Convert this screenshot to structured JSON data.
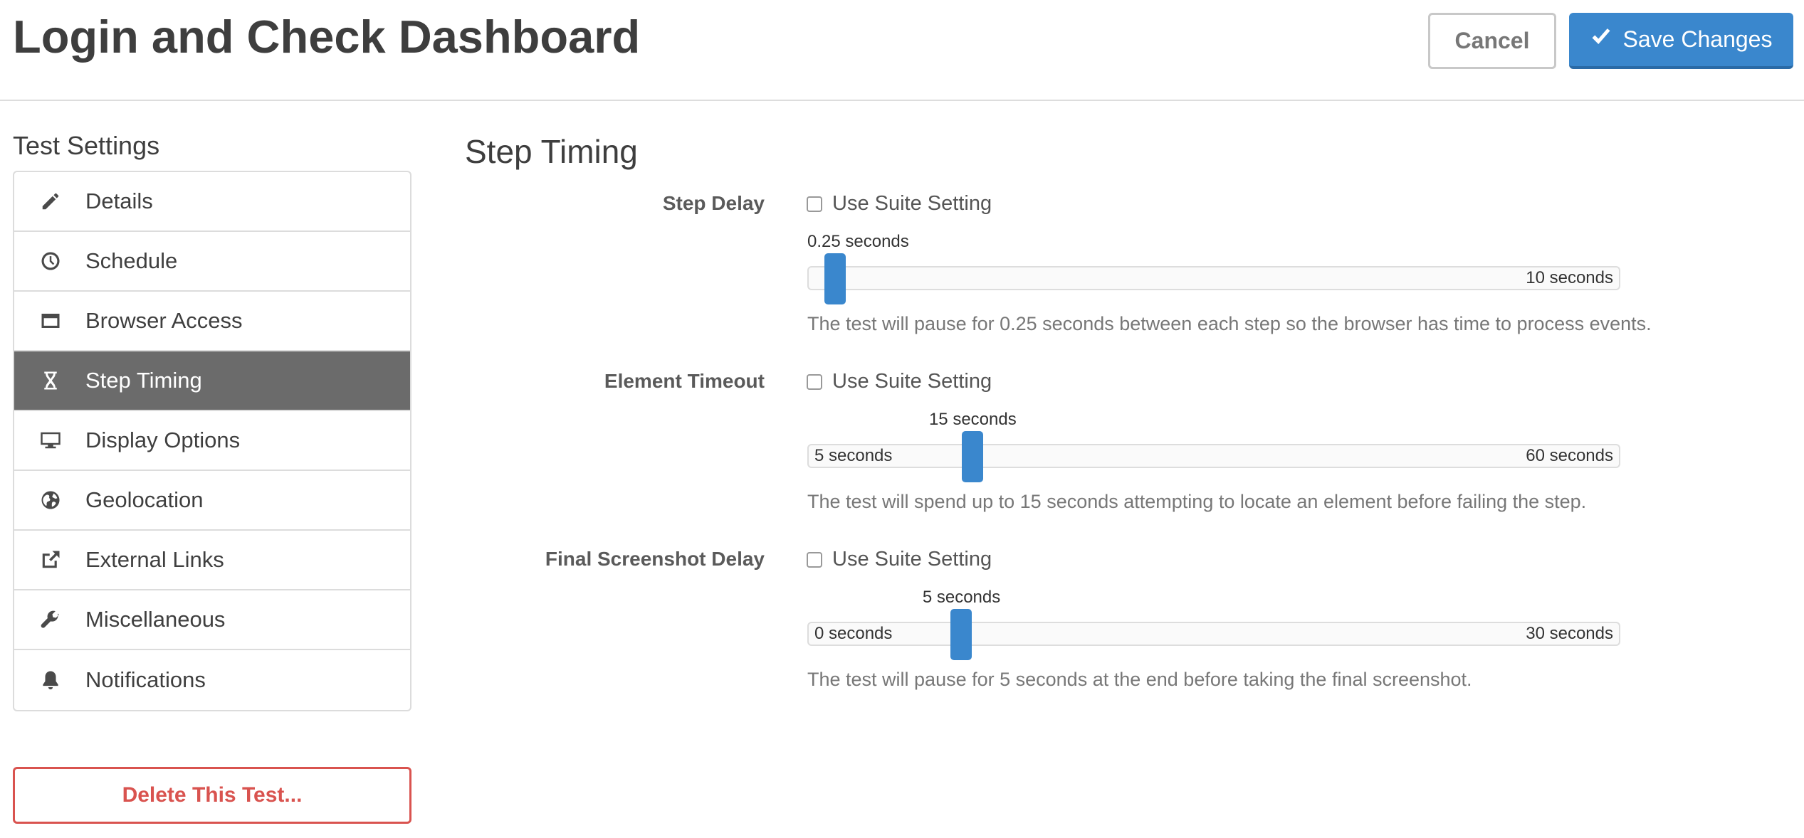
{
  "header": {
    "title": "Login and Check Dashboard",
    "cancel_label": "Cancel",
    "save_label": "Save Changes"
  },
  "sidebar": {
    "title": "Test Settings",
    "items": [
      {
        "label": "Details",
        "icon": "pencil-icon"
      },
      {
        "label": "Schedule",
        "icon": "clock-icon"
      },
      {
        "label": "Browser Access",
        "icon": "browser-window-icon"
      },
      {
        "label": "Step Timing",
        "icon": "hourglass-icon",
        "active": true
      },
      {
        "label": "Display Options",
        "icon": "monitor-icon"
      },
      {
        "label": "Geolocation",
        "icon": "globe-icon"
      },
      {
        "label": "External Links",
        "icon": "external-link-icon"
      },
      {
        "label": "Miscellaneous",
        "icon": "wrench-icon"
      },
      {
        "label": "Notifications",
        "icon": "bell-icon"
      }
    ],
    "delete_label": "Delete This Test..."
  },
  "main": {
    "title": "Step Timing",
    "fields": [
      {
        "label": "Step Delay",
        "suite_label": "Use Suite Setting",
        "suite_checked": false,
        "value_label": "0.25 seconds",
        "min_label": "",
        "max_label": "10 seconds",
        "value": 0.25,
        "min": 0.25,
        "max": 10,
        "description": "The test will pause for 0.25 seconds between each step so the browser has time to process events."
      },
      {
        "label": "Element Timeout",
        "suite_label": "Use Suite Setting",
        "suite_checked": false,
        "value_label": "15 seconds",
        "min_label": "5 seconds",
        "max_label": "60 seconds",
        "value": 15,
        "min": 5,
        "max": 60,
        "description": "The test will spend up to 15 seconds attempting to locate an element before failing the step."
      },
      {
        "label": "Final Screenshot Delay",
        "suite_label": "Use Suite Setting",
        "suite_checked": false,
        "value_label": "5 seconds",
        "min_label": "0 seconds",
        "max_label": "30 seconds",
        "value": 5,
        "min": 0,
        "max": 30,
        "description": "The test will pause for 5 seconds at the end before taking the final screenshot."
      }
    ]
  },
  "colors": {
    "accent": "#3a87cd",
    "active_nav": "#6b6b6b",
    "danger": "#d9534f"
  }
}
